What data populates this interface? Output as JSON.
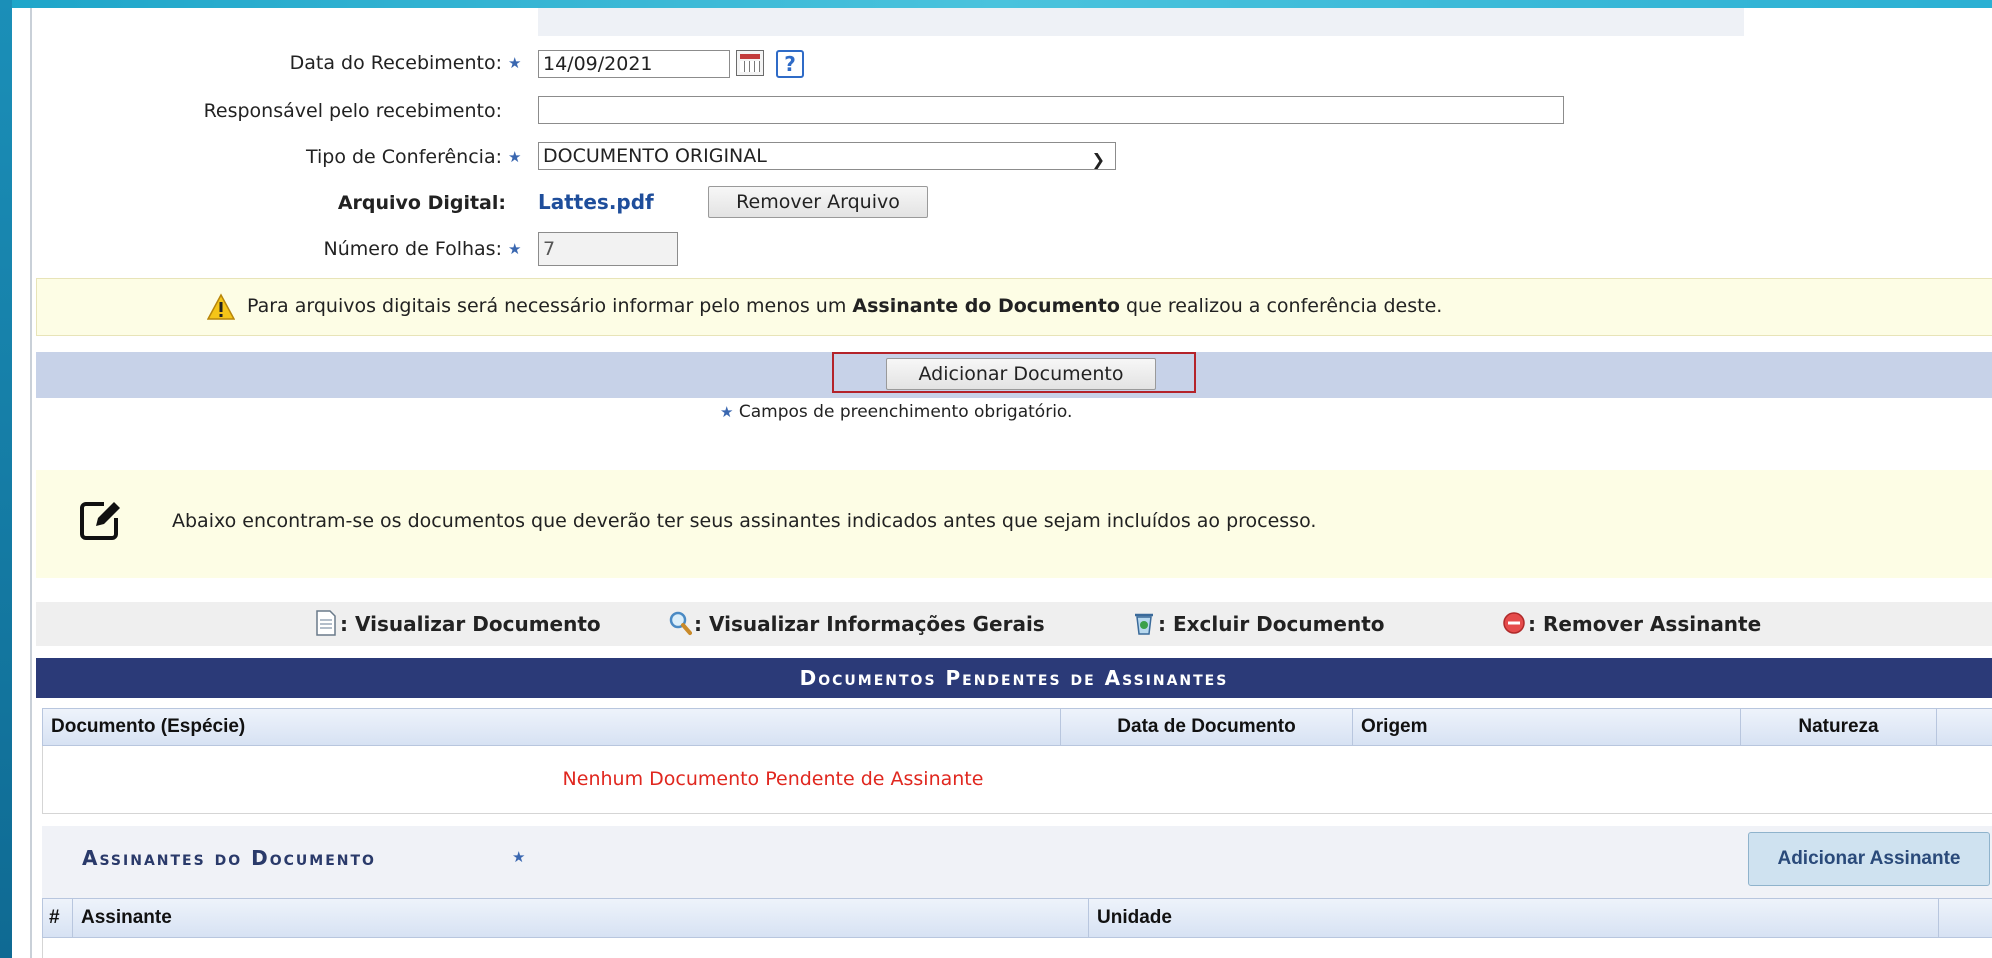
{
  "form": {
    "date_label": "Data do Recebimento:",
    "date_value": "14/09/2021",
    "help_symbol": "?",
    "responsible_label": "Responsável pelo recebimento:",
    "responsible_value": "",
    "conference_label": "Tipo de Conferência:",
    "conference_value": "DOCUMENTO ORIGINAL",
    "file_label": "Arquivo Digital:",
    "file_name": "Lattes.pdf",
    "remove_file_label": "Remover Arquivo",
    "pages_label": "Número de Folhas:",
    "pages_value": "7",
    "required_star": "★"
  },
  "warning": {
    "text_before": "Para arquivos digitais será necessário informar pelo menos um",
    "text_bold": "Assinante do Documento",
    "text_after": "que realizou a conferência deste."
  },
  "actions": {
    "add_document_label": "Adicionar Documento",
    "required_note": "Campos de preenchimento obrigatório."
  },
  "info": {
    "text": "Abaixo encontram-se os documentos que deverão ter seus assinantes indicados antes que sejam incluídos ao processo."
  },
  "legend": {
    "items": [
      {
        "icon": "document-icon",
        "label": ": Visualizar Documento"
      },
      {
        "icon": "magnifier-icon",
        "label": ": Visualizar Informações Gerais"
      },
      {
        "icon": "trash-icon",
        "label": ": Excluir Documento"
      },
      {
        "icon": "remove-circle-icon",
        "label": ": Remover Assinante"
      }
    ]
  },
  "pending_table": {
    "title": "Documentos Pendentes de Assinantes",
    "columns": [
      "Documento (Espécie)",
      "Data de Documento",
      "Origem",
      "Natureza"
    ],
    "empty_message": "Nenhum Documento Pendente de Assinante"
  },
  "signers": {
    "title": "Assinantes do Documento",
    "add_label": "Adicionar Assinante",
    "columns": [
      "#",
      "Assinante",
      "Unidade"
    ]
  },
  "colors": {
    "table_header": "#2b3a78",
    "warning_bg": "#fdfde5",
    "empty_text": "#e0271f",
    "highlight_border": "#b4232a"
  }
}
